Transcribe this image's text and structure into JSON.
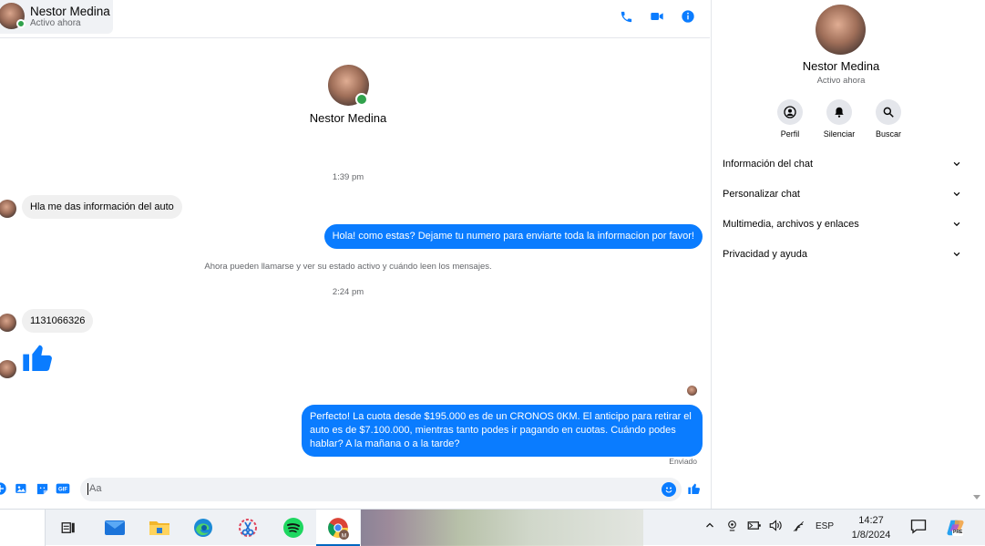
{
  "contact": {
    "name": "Nestor Medina",
    "status": "Activo ahora"
  },
  "messages": {
    "time1": "1:39 pm",
    "in1": "Hla me das información del auto",
    "out1": "Hola! como estas? Dejame tu numero para enviarte toda la informacion por favor!",
    "system": "Ahora pueden llamarse y ver su estado activo y cuándo leen los mensajes.",
    "time2": "2:24 pm",
    "in2": "1131066326",
    "out2_line1": "Perfecto! La cuota desde $195.000 es de un CRONOS 0KM. El anticipo para retirar el",
    "out2_line2": "auto es de $7.100.000, mientras tanto podes ir pagando en cuotas. Cuándo podes",
    "out2_line3": "hablar? A la mañana o a la tarde?",
    "sent": "Enviado"
  },
  "composer": {
    "placeholder": "Aa"
  },
  "side_panel": {
    "actions": [
      "Perfil",
      "Silenciar",
      "Buscar"
    ],
    "sections": [
      "Información del chat",
      "Personalizar chat",
      "Multimedia, archivos y enlaces",
      "Privacidad y ayuda"
    ]
  },
  "taskbar": {
    "language": "ESP",
    "time": "14:27",
    "date": "1/8/2024",
    "copilot_badge": "PRE"
  },
  "colors": {
    "accent": "#0a7cff",
    "online": "#31a24c"
  }
}
